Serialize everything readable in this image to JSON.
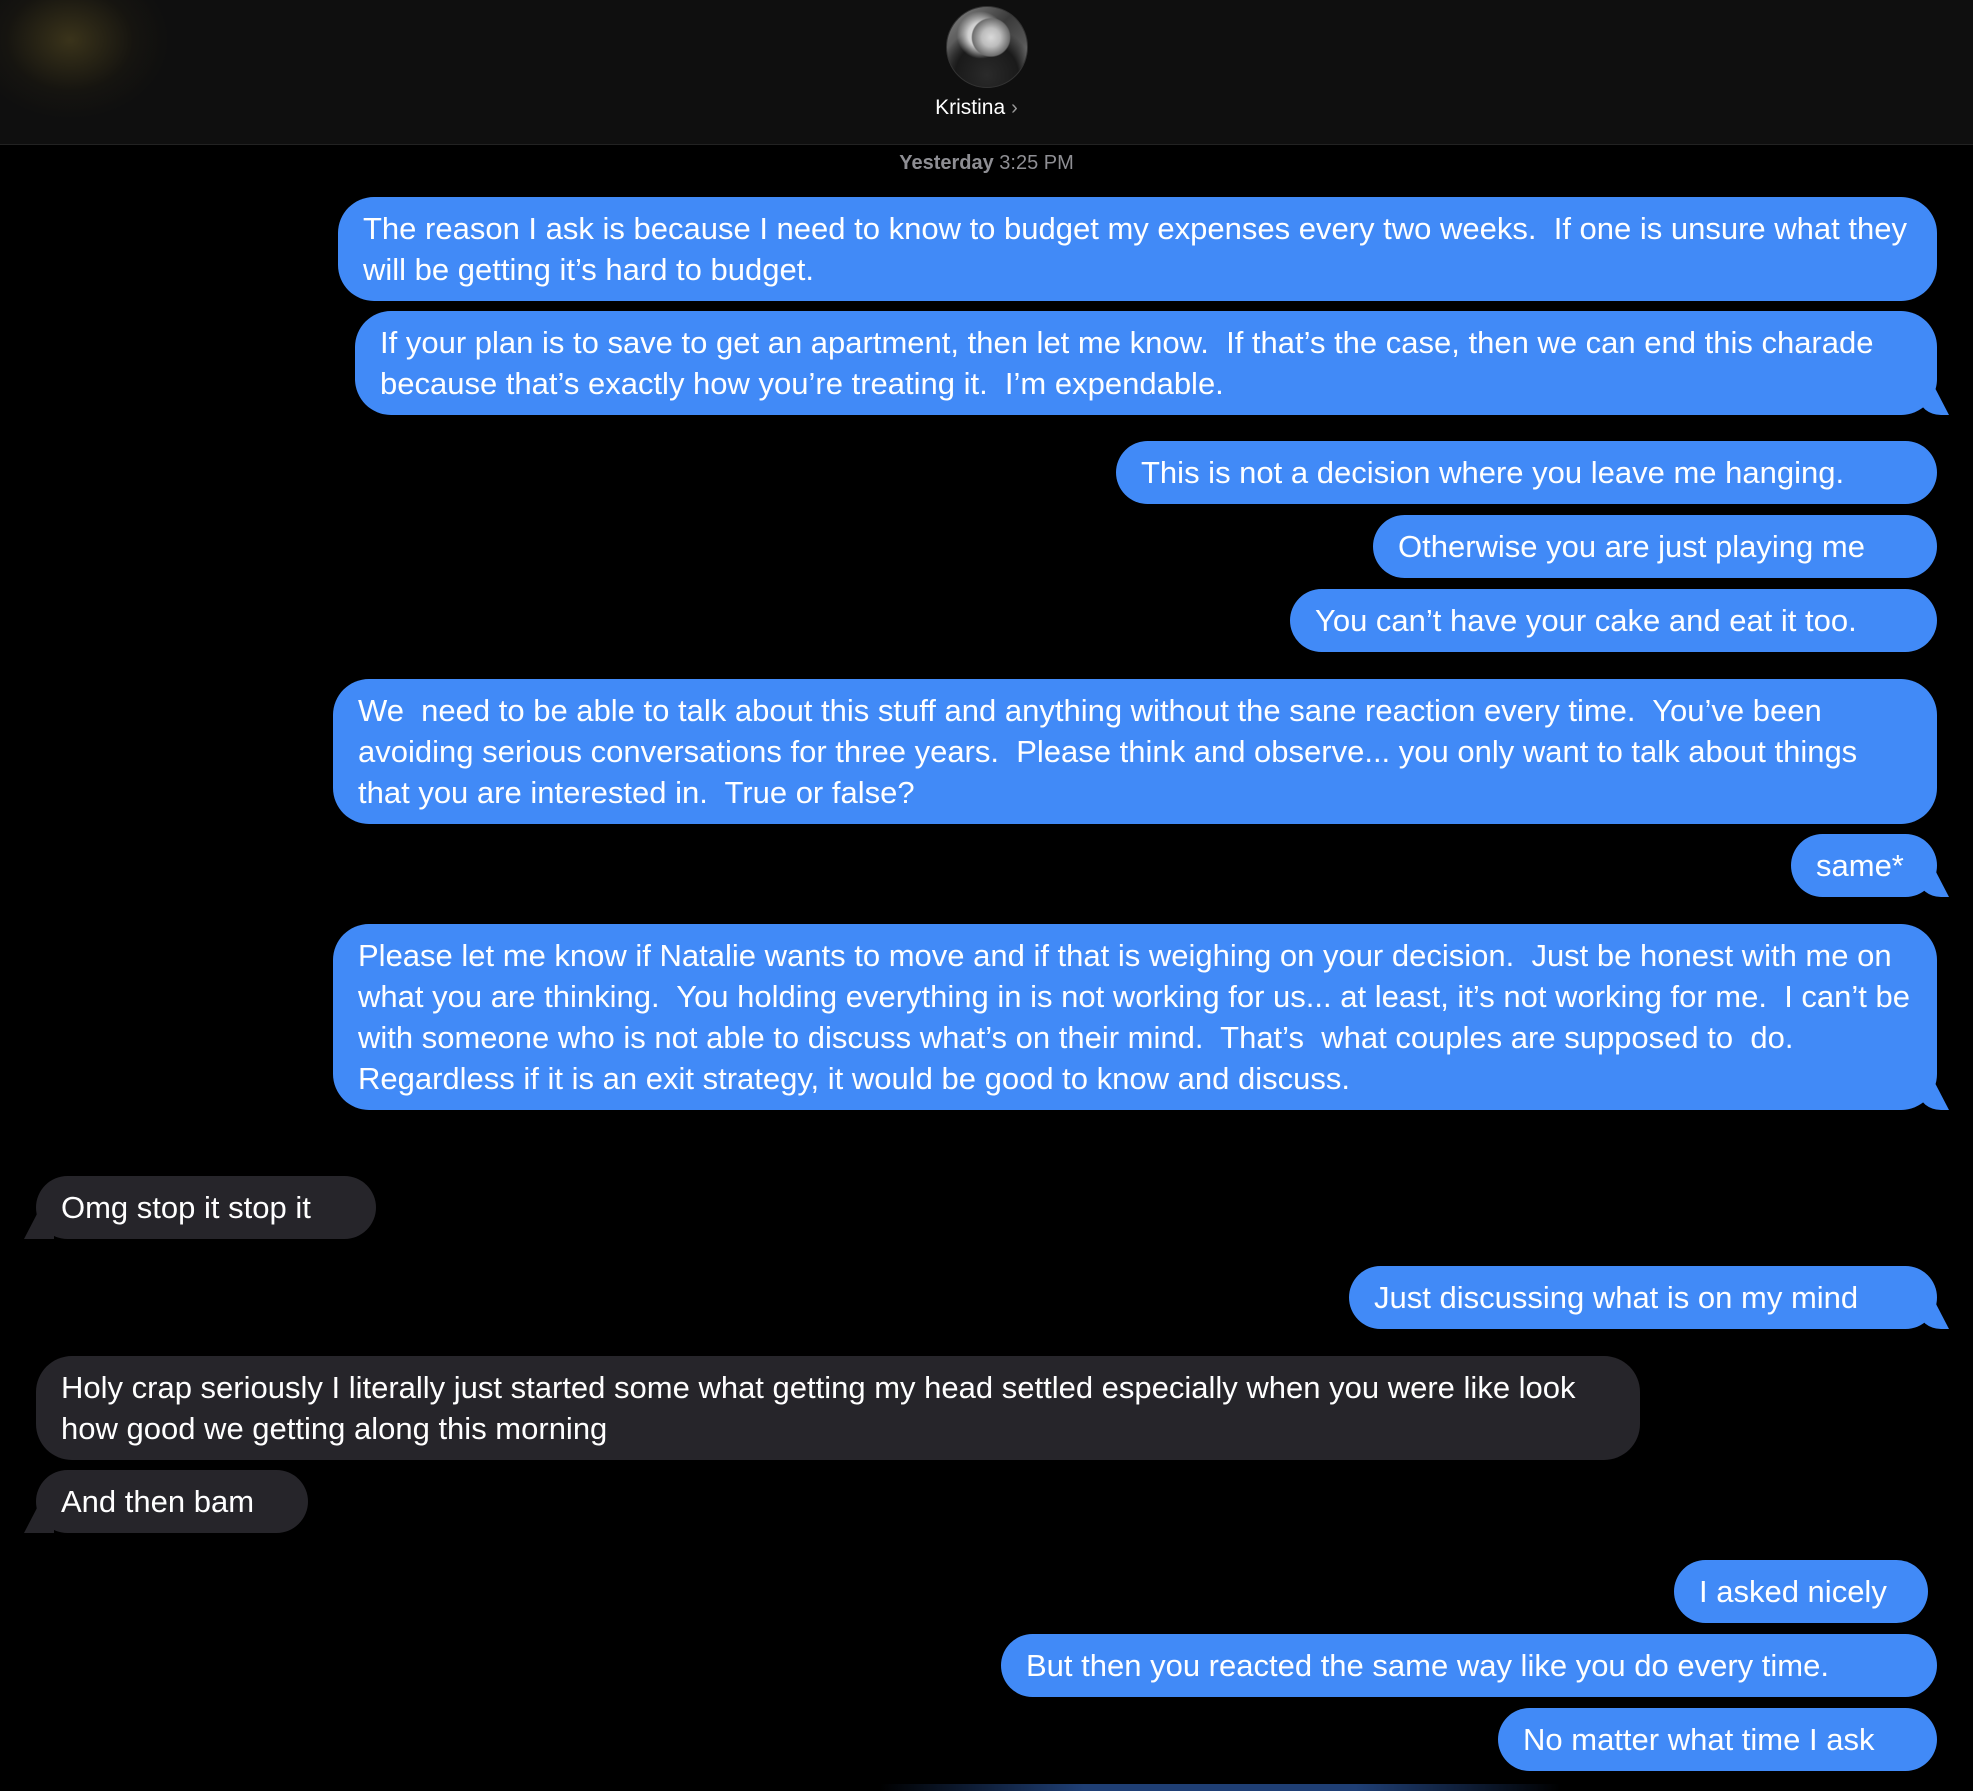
{
  "header": {
    "contact_name": "Kristina",
    "chevron": "›",
    "avatar_icon": "contact-photo"
  },
  "timestamp": {
    "day": "Yesterday",
    "time": "3:25 PM"
  },
  "messages": [
    {
      "from": "me",
      "text": "The reason I ask is because I need to know to budget my expenses every two weeks.  If one is unsure what they will be getting it’s hard to budget."
    },
    {
      "from": "me",
      "text": "If your plan is to save to get an apartment, then let me know.  If that’s the case, then we can end this charade because that’s exactly how you’re treating it.  I’m expendable."
    },
    {
      "from": "me",
      "text": "This is not a decision where you leave me hanging."
    },
    {
      "from": "me",
      "text": "Otherwise you are just playing me"
    },
    {
      "from": "me",
      "text": "You can’t have your cake and eat it too."
    },
    {
      "from": "me",
      "text": "We  need to be able to talk about this stuff and anything without the sane reaction every time.  You’ve been avoiding serious conversations for three years.  Please think and observe... you only want to talk about things that you are interested in.  True or false?"
    },
    {
      "from": "me",
      "text": "same*"
    },
    {
      "from": "me",
      "text": "Please let me know if Natalie wants to move and if that is weighing on your decision.  Just be honest with me on what you are thinking.  You holding everything in is not working for us... at least, it’s not working for me.  I can’t be with someone who is not able to discuss what’s on their mind.  That’s  what couples are supposed to  do.  Regardless if it is an exit strategy, it would be good to know and discuss."
    },
    {
      "from": "them",
      "text": "Omg stop it stop it"
    },
    {
      "from": "me",
      "text": "Just discussing what is on my mind"
    },
    {
      "from": "them",
      "text": "Holy crap seriously I literally just started some what getting my head settled especially when you were like look how good we getting along this morning"
    },
    {
      "from": "them",
      "text": "And then bam"
    },
    {
      "from": "me",
      "text": "I asked nicely"
    },
    {
      "from": "me",
      "text": "But then you reacted the same way like you do every time."
    },
    {
      "from": "me",
      "text": "No matter what time I ask"
    }
  ],
  "colors": {
    "sent_bubble": "#418af7",
    "received_bubble": "#26252a",
    "background": "#000000"
  }
}
